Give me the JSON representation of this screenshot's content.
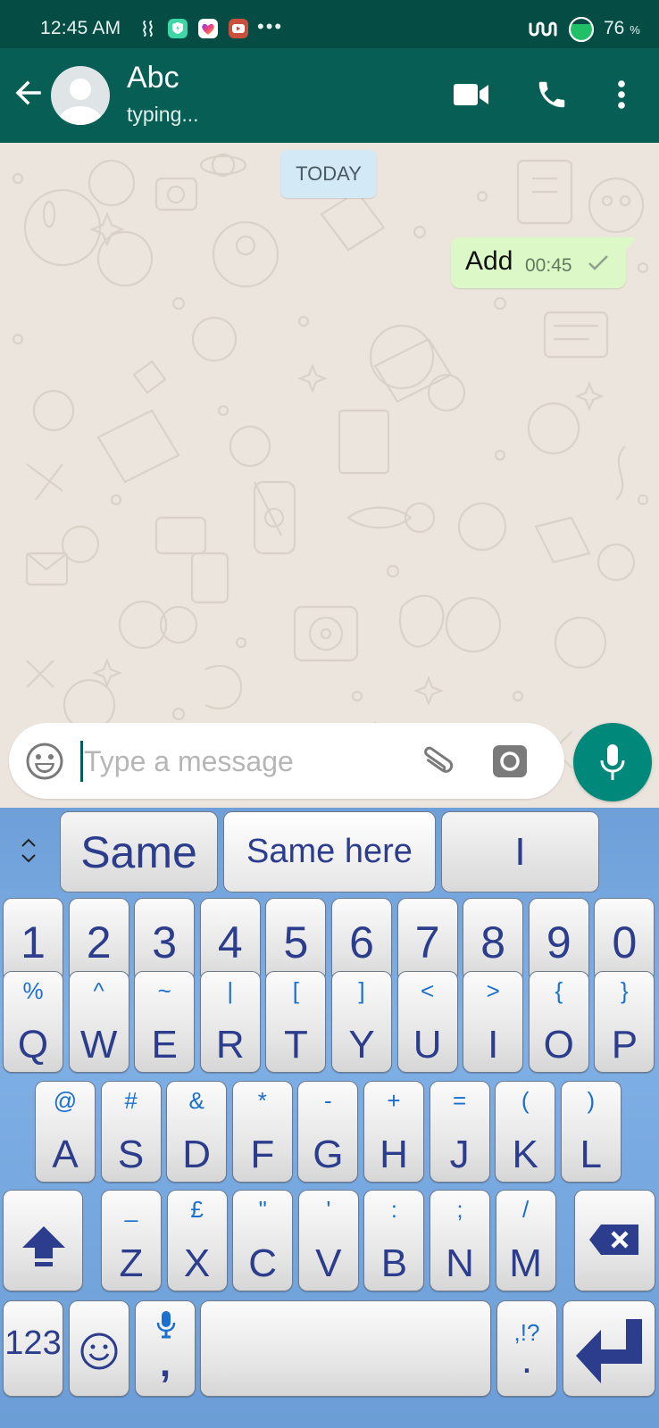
{
  "status_bar": {
    "time": "12:45 AM",
    "notification_icons": [
      "signal-waves-icon",
      "security-shield-icon",
      "likee-heart-icon",
      "video-app-icon"
    ],
    "more_indicator": "•••",
    "battery_percent": "76",
    "battery_unit": "%"
  },
  "header": {
    "contact_name": "Abc",
    "contact_status": "typing...",
    "actions": [
      "video-call",
      "voice-call",
      "more-options"
    ]
  },
  "chat": {
    "date_chip": "TODAY",
    "messages": [
      {
        "text": "Add",
        "time": "00:45",
        "direction": "outgoing",
        "status": "sent"
      }
    ]
  },
  "composer": {
    "placeholder": "Type a message",
    "value": ""
  },
  "keyboard": {
    "suggestions": [
      "Same",
      "Same here",
      "I"
    ],
    "number_row": [
      "1",
      "2",
      "3",
      "4",
      "5",
      "6",
      "7",
      "8",
      "9",
      "0"
    ],
    "row1": [
      {
        "key": "Q",
        "alt": "%"
      },
      {
        "key": "W",
        "alt": "^"
      },
      {
        "key": "E",
        "alt": "~"
      },
      {
        "key": "R",
        "alt": "|"
      },
      {
        "key": "T",
        "alt": "["
      },
      {
        "key": "Y",
        "alt": "]"
      },
      {
        "key": "U",
        "alt": "<"
      },
      {
        "key": "I",
        "alt": ">"
      },
      {
        "key": "O",
        "alt": "{"
      },
      {
        "key": "P",
        "alt": "}"
      }
    ],
    "row2": [
      {
        "key": "A",
        "alt": "@"
      },
      {
        "key": "S",
        "alt": "#"
      },
      {
        "key": "D",
        "alt": "&"
      },
      {
        "key": "F",
        "alt": "*"
      },
      {
        "key": "G",
        "alt": "-"
      },
      {
        "key": "H",
        "alt": "+"
      },
      {
        "key": "J",
        "alt": "="
      },
      {
        "key": "K",
        "alt": "("
      },
      {
        "key": "L",
        "alt": ")"
      }
    ],
    "row3": [
      {
        "key": "Z",
        "alt": "_"
      },
      {
        "key": "X",
        "alt": "£"
      },
      {
        "key": "C",
        "alt": "\""
      },
      {
        "key": "V",
        "alt": "'"
      },
      {
        "key": "B",
        "alt": ":"
      },
      {
        "key": "N",
        "alt": ";"
      },
      {
        "key": "M",
        "alt": "/"
      }
    ],
    "bottom": {
      "symbols_label": "123",
      "comma_label": ",",
      "period_label": ".",
      "period_alt": ",!?"
    }
  },
  "colors": {
    "status_bar": "#054d44",
    "header": "#075e54",
    "outgoing_bubble": "#dcf8c6",
    "date_chip": "#d3e9f5",
    "mic_button": "#00897b",
    "keyboard_bg": "#7aaae0",
    "key_text": "#2b3d8c",
    "key_alt_text": "#1a6fd0"
  }
}
